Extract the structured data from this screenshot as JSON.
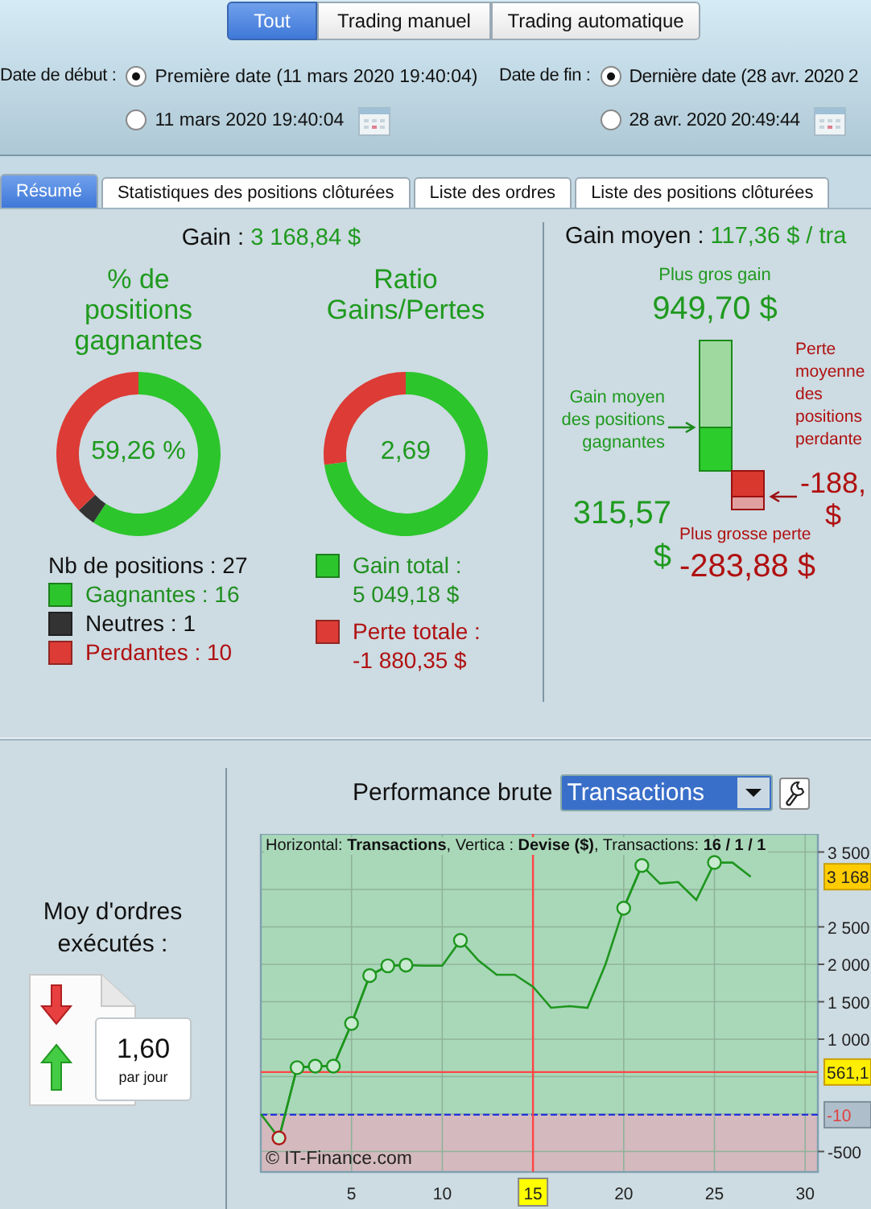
{
  "mode_tabs": [
    {
      "label": "Tout",
      "selected": true
    },
    {
      "label": "Trading manuel",
      "selected": false
    },
    {
      "label": "Trading automatique",
      "selected": false
    }
  ],
  "start_date": {
    "label": "Date de début :",
    "options": [
      {
        "label": "Première date (11 mars 2020 19:40:04)",
        "selected": true,
        "kind": "text"
      },
      {
        "label": "11 mars 2020 19:40:04",
        "selected": false,
        "kind": "date"
      }
    ]
  },
  "end_date": {
    "label": "Date de fin :",
    "options": [
      {
        "label": "Dernière date (28 avr. 2020 2",
        "selected": true,
        "kind": "text"
      },
      {
        "label": "28 avr. 2020 20:49:44",
        "selected": false,
        "kind": "date"
      }
    ]
  },
  "tabs": [
    {
      "label": "Résumé",
      "selected": true
    },
    {
      "label": "Statistiques des positions clôturées",
      "selected": false
    },
    {
      "label": "Liste des ordres",
      "selected": false
    },
    {
      "label": "Liste des positions clôturées",
      "selected": false
    }
  ],
  "summary": {
    "gain_label": "Gain :",
    "gain_value": "3 168,84 $",
    "win_rate": {
      "title": "% de\npositions\ngagnantes",
      "value": "59,26 %",
      "chart_data": {
        "type": "donut",
        "values": [
          59.26,
          3.7,
          37.04
        ]
      }
    },
    "ratio": {
      "title": "Ratio\nGains/Pertes",
      "value": "2,69",
      "chart_data": {
        "type": "donut",
        "values": [
          72.87,
          27.13
        ]
      }
    },
    "positions_label": "Nb de positions : 27",
    "position_legend": [
      {
        "label": "Gagnantes : 16",
        "color": "#2cc52c"
      },
      {
        "label": "Neutres : 1",
        "color": "#333333"
      },
      {
        "label": "Perdantes : 10",
        "color": "#dd3b35"
      }
    ],
    "totals_legend": [
      {
        "label": "Gain total :\n5 049,18 $",
        "color": "#2cc52c"
      },
      {
        "label": "Perte totale :\n-1 880,35 $",
        "color": "#dd3b35"
      }
    ]
  },
  "average_gain": {
    "label": "Gain moyen :",
    "value": "117,36 $ / tra",
    "largest_gain_label": "Plus gros gain",
    "largest_gain": "949,70 $",
    "avg_win_label": "Gain moyen\ndes positions\ngagnantes",
    "avg_win": "315,57\n$",
    "avg_loss_label": "Perte\nmoyenne\ndes\npositions\nperdante",
    "avg_loss": "-188,\n$",
    "largest_loss_label": "Plus grosse perte",
    "largest_loss": "-283,88 $"
  },
  "orders": {
    "label": "Moy d'ordres\nexécutés :",
    "value": "1,60",
    "unit": "par jour"
  },
  "performance": {
    "label": "Performance brute",
    "dropdown": "Transactions",
    "info": "Horizontal: **Transactions**, Vertica : **Devise ($)**, Transactions: **16 / 1 / 1**",
    "credit": "© IT-Finance.com",
    "last_value_label": "3 168",
    "chart_data": {
      "type": "line",
      "grid": true,
      "x": [
        0,
        1,
        2,
        3,
        4,
        5,
        6,
        7,
        8,
        9,
        10,
        11,
        12,
        13,
        14,
        15,
        16,
        17,
        18,
        19,
        20,
        21,
        22,
        23,
        24,
        25,
        26,
        27
      ],
      "series": [
        {
          "color": "#1e961e",
          "values": [
            0,
            -320,
            620,
            640,
            640,
            1210,
            1850,
            1980,
            1990,
            1980,
            1980,
            2320,
            2050,
            1860,
            1860,
            1700,
            1420,
            1440,
            1420,
            2000,
            2750,
            3320,
            3080,
            3100,
            2860,
            3360,
            3360,
            3170
          ]
        },
        {
          "color": "#1e961e",
          "values": [
            null,
            -320,
            620,
            640,
            640,
            1210,
            1850,
            1980,
            1990,
            null,
            null,
            2320,
            null,
            null,
            null,
            null,
            null,
            null,
            null,
            null,
            2750,
            3320,
            null,
            null,
            null,
            3360,
            null,
            null
          ]
        }
      ],
      "xlim": [
        0,
        30.7
      ],
      "ylim": [
        -774,
        3742
      ],
      "xticks": [
        5,
        10,
        15,
        20,
        25,
        30
      ],
      "yticks": [
        {
          "value": 3500,
          "label": "3 500"
        },
        {
          "value": 2500,
          "label": "2 500"
        },
        {
          "value": 2000,
          "label": "2 000"
        },
        {
          "value": 1500,
          "label": "1 500"
        },
        {
          "value": 1000,
          "label": "1 000"
        },
        {
          "value": -500,
          "label": "-500"
        }
      ],
      "ref_lines": [
        {
          "axis": "y",
          "value": 561.1,
          "label": "561,1"
        },
        {
          "axis": "y",
          "value": -10,
          "label": "-10"
        },
        {
          "axis": "x",
          "value": 15,
          "label": "15"
        }
      ]
    }
  }
}
